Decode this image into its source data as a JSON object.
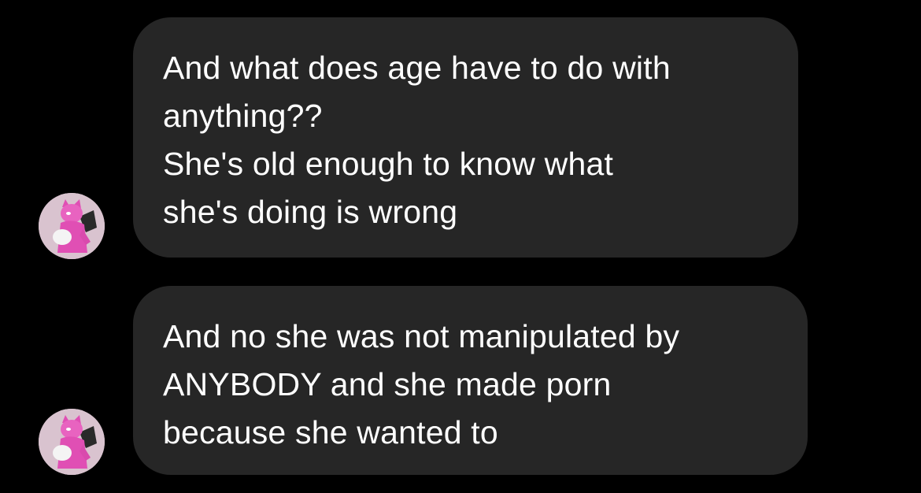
{
  "messages": [
    {
      "sender": "received",
      "avatar_icon": "character-avatar-icon",
      "paragraphs": [
        [
          "And what does age have to do with",
          "anything??"
        ],
        [
          "She's old enough to know what",
          "she's doing is wrong"
        ]
      ]
    },
    {
      "sender": "received",
      "avatar_icon": "character-avatar-icon",
      "paragraphs": [
        [
          "And no she was not manipulated by",
          "ANYBODY and she made porn",
          "because she wanted to"
        ]
      ]
    }
  ],
  "colors": {
    "background": "#000000",
    "bubble": "#262626",
    "text": "#ffffff",
    "avatar_bg": "#d9c3cf",
    "avatar_figure": "#e04fb4"
  }
}
